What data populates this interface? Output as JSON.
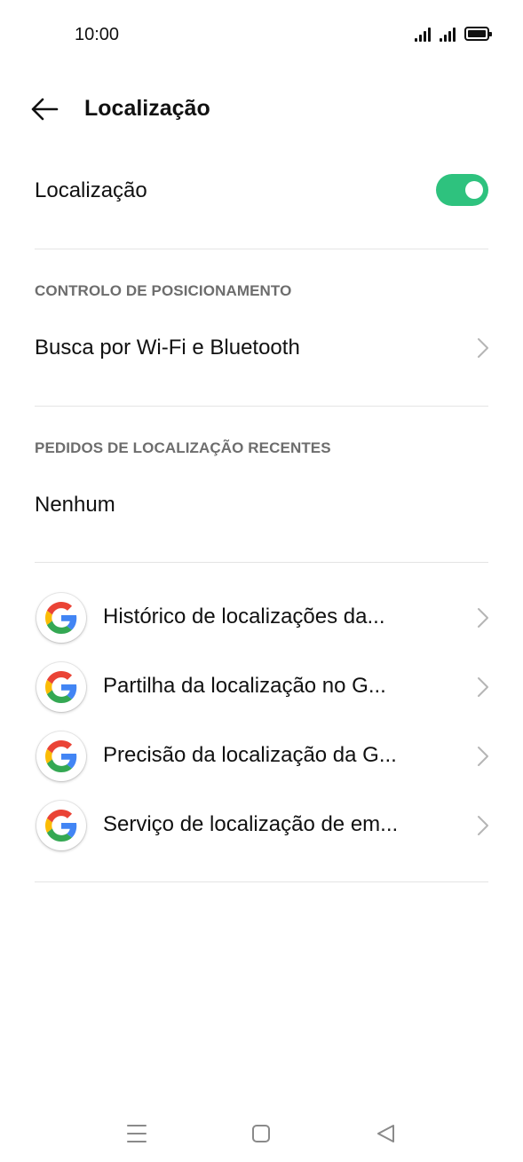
{
  "status_bar": {
    "time": "10:00",
    "icons": [
      "signal-icon",
      "signal-icon",
      "battery-icon"
    ]
  },
  "header": {
    "title": "Localização",
    "back_icon": "arrow-left-icon"
  },
  "location_toggle": {
    "label": "Localização",
    "enabled": true,
    "accent_color": "#2ec27e"
  },
  "positioning_section": {
    "header": "CONTROLO DE POSICIONAMENTO",
    "items": [
      {
        "label": "Busca por Wi-Fi e Bluetooth",
        "icon": "chevron-right-icon"
      }
    ]
  },
  "recent_requests_section": {
    "header": "PEDIDOS DE LOCALIZAÇÃO RECENTES",
    "empty_text": "Nenhum"
  },
  "google_services": [
    {
      "label": "Histórico de localizações da...",
      "icon": "google-icon"
    },
    {
      "label": "Partilha da localização no G...",
      "icon": "google-icon"
    },
    {
      "label": "Precisão da localização da G...",
      "icon": "google-icon"
    },
    {
      "label": "Serviço de localização de em...",
      "icon": "google-icon"
    }
  ],
  "nav_bar": {
    "buttons": [
      "menu-icon",
      "home-icon",
      "back-triangle-icon"
    ]
  }
}
